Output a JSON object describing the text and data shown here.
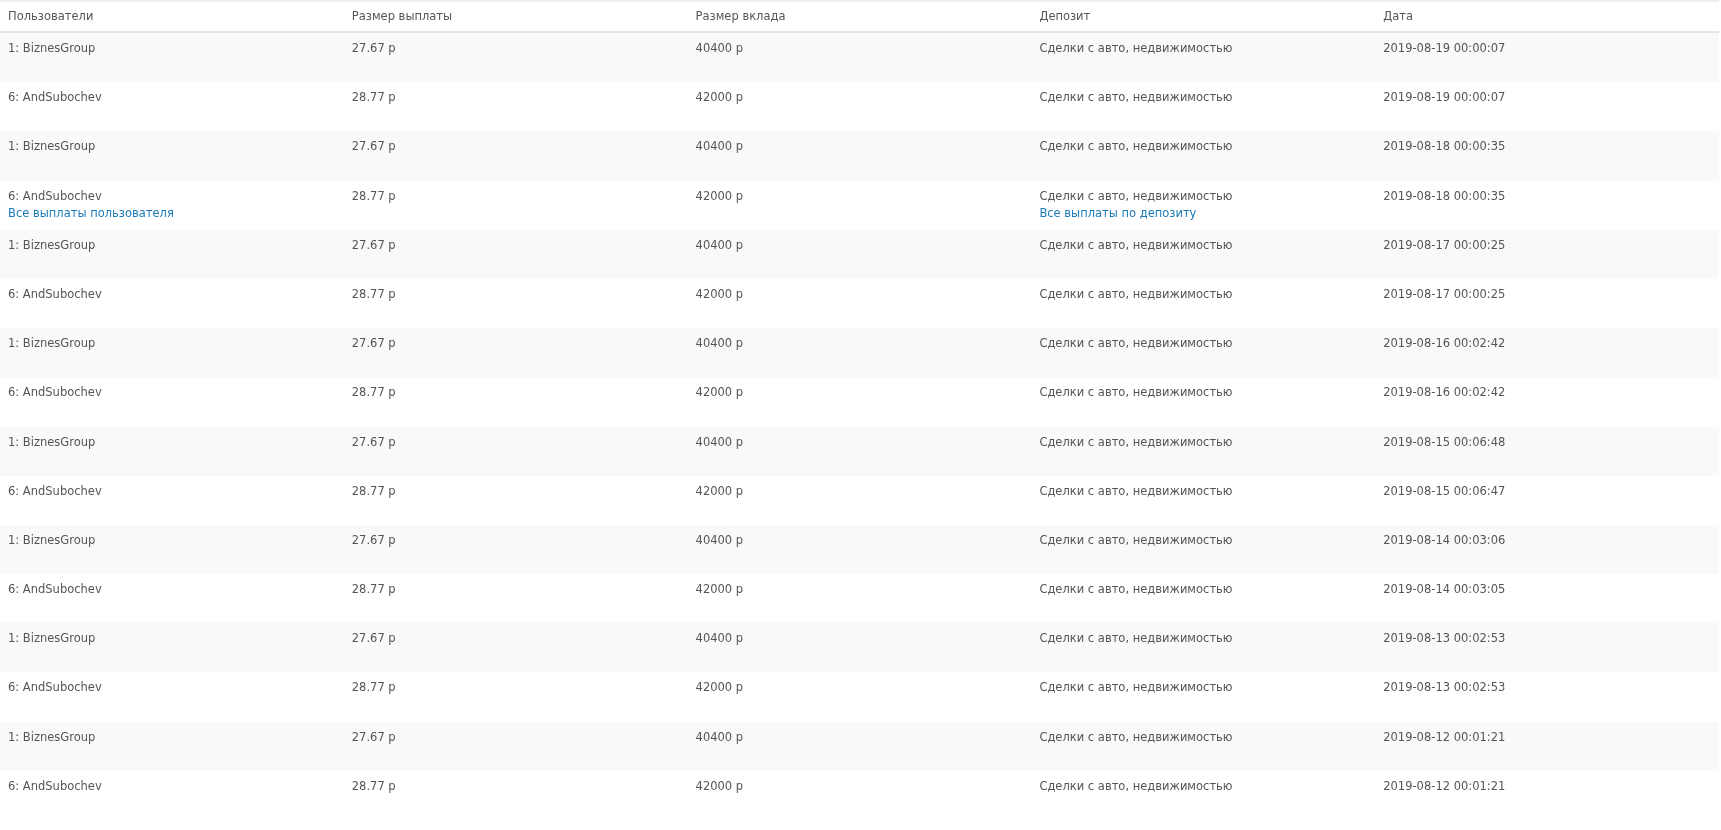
{
  "table": {
    "columns": [
      "Пользователи",
      "Размер выплаты",
      "Размер вклада",
      "Депозит",
      "Дата"
    ],
    "rows": [
      {
        "user": "1: BiznesGroup",
        "payout": "27.67 р",
        "amount": "40400 р",
        "deposit": "Сделки с авто, недвижимостью",
        "date": "2019-08-19 00:00:07"
      },
      {
        "user": "6: AndSubochev",
        "payout": "28.77 р",
        "amount": "42000 р",
        "deposit": "Сделки с авто, недвижимостью",
        "date": "2019-08-19 00:00:07"
      },
      {
        "user": "1: BiznesGroup",
        "payout": "27.67 р",
        "amount": "40400 р",
        "deposit": "Сделки с авто, недвижимостью",
        "date": "2019-08-18 00:00:35"
      },
      {
        "user": "6: AndSubochev",
        "payout": "28.77 р",
        "amount": "42000 р",
        "deposit": "Сделки с авто, недвижимостью",
        "date": "2019-08-18 00:00:35",
        "user_link": "Все выплаты пользователя",
        "deposit_link": "Все выплаты по депозиту"
      },
      {
        "user": "1: BiznesGroup",
        "payout": "27.67 р",
        "amount": "40400 р",
        "deposit": "Сделки с авто, недвижимостью",
        "date": "2019-08-17 00:00:25"
      },
      {
        "user": "6: AndSubochev",
        "payout": "28.77 р",
        "amount": "42000 р",
        "deposit": "Сделки с авто, недвижимостью",
        "date": "2019-08-17 00:00:25"
      },
      {
        "user": "1: BiznesGroup",
        "payout": "27.67 р",
        "amount": "40400 р",
        "deposit": "Сделки с авто, недвижимостью",
        "date": "2019-08-16 00:02:42"
      },
      {
        "user": "6: AndSubochev",
        "payout": "28.77 р",
        "amount": "42000 р",
        "deposit": "Сделки с авто, недвижимостью",
        "date": "2019-08-16 00:02:42"
      },
      {
        "user": "1: BiznesGroup",
        "payout": "27.67 р",
        "amount": "40400 р",
        "deposit": "Сделки с авто, недвижимостью",
        "date": "2019-08-15 00:06:48"
      },
      {
        "user": "6: AndSubochev",
        "payout": "28.77 р",
        "amount": "42000 р",
        "deposit": "Сделки с авто, недвижимостью",
        "date": "2019-08-15 00:06:47"
      },
      {
        "user": "1: BiznesGroup",
        "payout": "27.67 р",
        "amount": "40400 р",
        "deposit": "Сделки с авто, недвижимостью",
        "date": "2019-08-14 00:03:06"
      },
      {
        "user": "6: AndSubochev",
        "payout": "28.77 р",
        "amount": "42000 р",
        "deposit": "Сделки с авто, недвижимостью",
        "date": "2019-08-14 00:03:05"
      },
      {
        "user": "1: BiznesGroup",
        "payout": "27.67 р",
        "amount": "40400 р",
        "deposit": "Сделки с авто, недвижимостью",
        "date": "2019-08-13 00:02:53"
      },
      {
        "user": "6: AndSubochev",
        "payout": "28.77 р",
        "amount": "42000 р",
        "deposit": "Сделки с авто, недвижимостью",
        "date": "2019-08-13 00:02:53"
      },
      {
        "user": "1: BiznesGroup",
        "payout": "27.67 р",
        "amount": "40400 р",
        "deposit": "Сделки с авто, недвижимостью",
        "date": "2019-08-12 00:01:21"
      },
      {
        "user": "6: AndSubochev",
        "payout": "28.77 р",
        "amount": "42000 р",
        "deposit": "Сделки с авто, недвижимостью",
        "date": "2019-08-12 00:01:21"
      }
    ]
  }
}
